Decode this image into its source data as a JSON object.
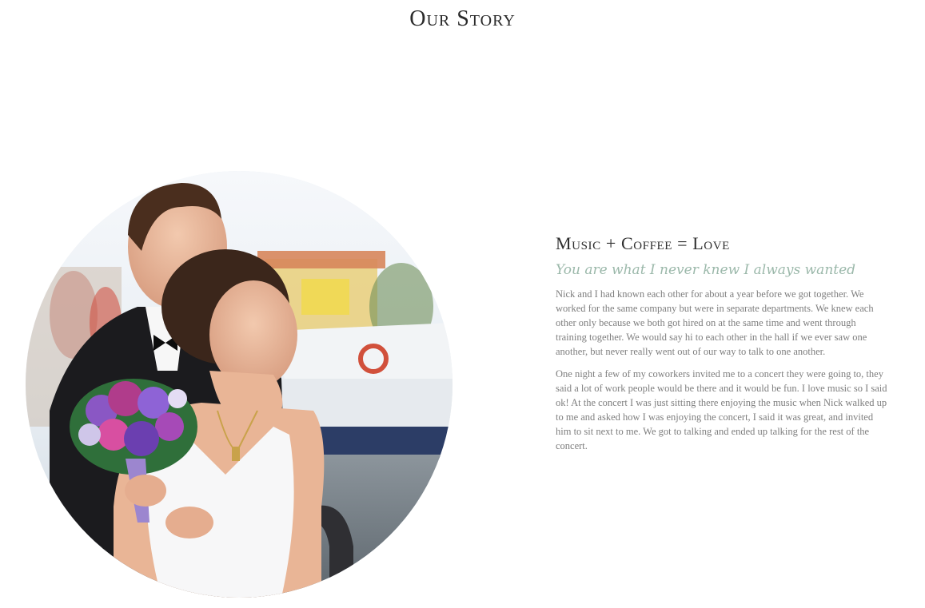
{
  "page": {
    "title": "Our Story"
  },
  "story": {
    "heading": "Music + Coffee = Love",
    "tagline": "You are what I never knew I always wanted",
    "paragraphs": [
      "Nick and I had known each other for about a year before we got together. We worked for the same company but were in separate departments. We knew each other only because we both got hired on at the same time and went through training together. We would say hi to each other in the hall if we ever saw one another, but never really went out of our way to talk to one another.",
      "One night a few of my coworkers invited me to a concert they were going to, they said a lot of work people would be there and it would be fun. I love music so I said ok! At the concert I was just sitting there enjoying the music when Nick walked up to me and asked how I was enjoying the concert, I said it was great, and invited him to sit next to me. We got to talking and ended up talking for the rest of the concert."
    ]
  },
  "colors": {
    "title": "#2b2b2b",
    "tagline": "#9bb8aa",
    "body_text": "#7e7e7e"
  }
}
